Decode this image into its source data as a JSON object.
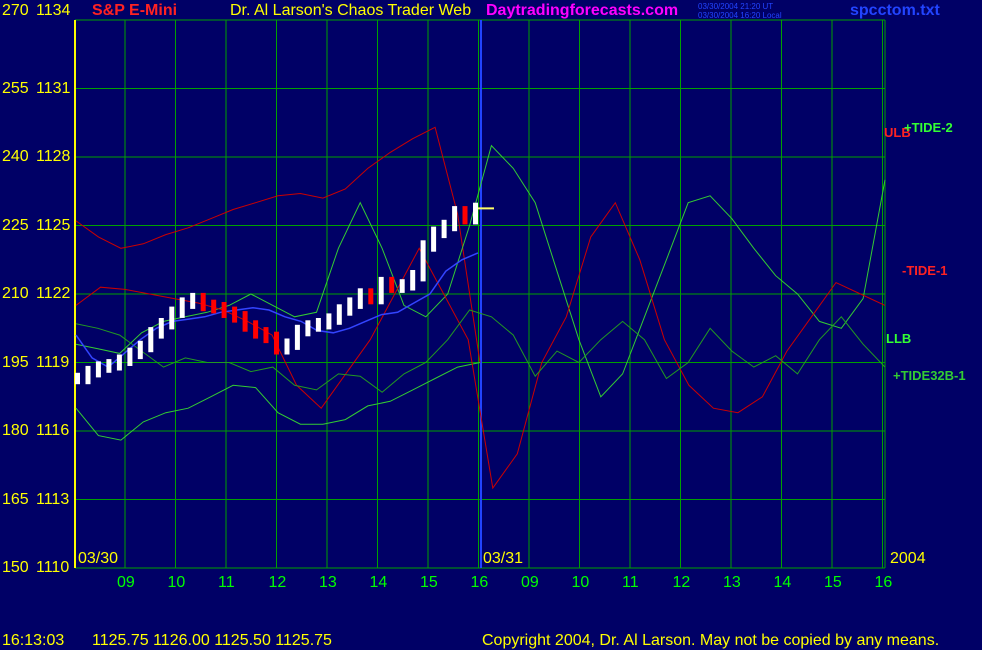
{
  "header": {
    "symbol": "S&P E-Mini",
    "title": "Dr. Al Larson's Chaos Trader Web",
    "site": "Daytradingforecasts.com",
    "timestamp_ut": "03/30/2004 21:20 UT",
    "timestamp_local": "03/30/2004 16:20 Local",
    "filename": "spcctom.txt"
  },
  "footer": {
    "time": "16:13:03",
    "ohlc": "1125.75 1126.00 1125.50 1125.75",
    "copyright": "Copyright 2004, Dr. Al Larson. May not be copied by any means."
  },
  "colors": {
    "background": "#000066",
    "grid": "#00a000",
    "price_up": "#ffffff",
    "price_down": "#ff0000",
    "ulb": "#cc0000",
    "llb": "#33cc33",
    "tide2": "#33cc33",
    "tide1": "#cc0000",
    "tide32b": "#229922",
    "average": "#3344ff",
    "fast_avg": "#ffff66",
    "axis_left": "#ffff00",
    "hour_label": "#00ff00",
    "magenta": "#ff00ff",
    "blue_text": "#2244ff"
  },
  "chart_data": {
    "type": "line",
    "title": "S&P E-Mini",
    "y_left_ticks": [
      "270",
      "255",
      "240",
      "225",
      "210",
      "195",
      "180",
      "165",
      "150"
    ],
    "y_right_ticks": [
      "1134",
      "1131",
      "1128",
      "1125",
      "1122",
      "1119",
      "1116",
      "1113",
      "1110"
    ],
    "ylim": [
      1110,
      1134
    ],
    "x_hour_labels": [
      "09",
      "10",
      "11",
      "12",
      "13",
      "14",
      "15",
      "16",
      "09",
      "10",
      "11",
      "12",
      "13",
      "14",
      "15",
      "16"
    ],
    "date_labels": [
      "03/30",
      "03/31",
      "2004"
    ],
    "series_labels": [
      {
        "text": "ULB",
        "color": "#ff2222"
      },
      {
        "text": "+TIDE-2",
        "color": "#33ff33"
      },
      {
        "text": "-TIDE-1",
        "color": "#ff2222"
      },
      {
        "text": "LLB",
        "color": "#33ff33"
      },
      {
        "text": "+TIDE32B-1",
        "color": "#33cc33"
      }
    ],
    "price": [
      1118.3,
      1118.6,
      1118.8,
      1118.9,
      1119.1,
      1119.4,
      1119.7,
      1120.3,
      1120.7,
      1121.2,
      1121.6,
      1121.8,
      1121.5,
      1121.4,
      1121.2,
      1121.0,
      1120.6,
      1120.3,
      1120.1,
      1119.6,
      1119.8,
      1120.4,
      1120.6,
      1120.7,
      1120.9,
      1121.3,
      1121.6,
      1122.0,
      1121.8,
      1122.5,
      1122.3,
      1122.4,
      1122.8,
      1124.1,
      1124.7,
      1125.0,
      1125.6,
      1125.3,
      1125.75
    ],
    "ulb": [
      1125.2,
      1124.5,
      1124.0,
      1124.2,
      1124.6,
      1124.9,
      1125.3,
      1125.7,
      1126.0,
      1126.3,
      1126.4,
      1126.2,
      1126.6,
      1127.5,
      1128.2,
      1128.8,
      1129.3,
      1125.5,
      1119.0
    ],
    "llb": [
      1117.0,
      1115.8,
      1115.6,
      1116.4,
      1116.8,
      1117.0,
      1117.5,
      1118.0,
      1117.9,
      1116.8,
      1116.3,
      1116.3,
      1116.5,
      1117.1,
      1117.3,
      1117.8,
      1118.3,
      1118.8,
      1119.0
    ],
    "tide2": [
      1119.8,
      1119.6,
      1119.4,
      1120.3,
      1120.8,
      1121.0,
      1121.2,
      1121.5,
      1122.0,
      1121.5,
      1121.0,
      1121.2,
      1124.0,
      1126.0,
      1124.0,
      1121.5,
      1121.0,
      1122.0,
      1125.0,
      1128.5,
      1127.5,
      1126.0,
      1123.0,
      1120.0,
      1117.5,
      1118.5,
      1121.0,
      1123.5,
      1126.0,
      1126.3,
      1125.3,
      1124.0,
      1122.8,
      1122.0,
      1120.8,
      1120.5,
      1121.8,
      1127.0
    ],
    "tide1": [
      1121.5,
      1122.3,
      1122.2,
      1122.0,
      1121.8,
      1121.6,
      1121.3,
      1120.8,
      1120.2,
      1118.0,
      1117.0,
      1118.5,
      1120.0,
      1122.0,
      1124.0,
      1122.0,
      1120.0,
      1113.5,
      1115.0,
      1119.0,
      1121.0,
      1124.5,
      1126.0,
      1123.5,
      1120.0,
      1118.0,
      1117.0,
      1116.8,
      1117.5,
      1119.5,
      1121.0,
      1122.5,
      1122.0,
      1121.5
    ],
    "tide32b": [
      1120.7,
      1120.5,
      1120.2,
      1119.5,
      1118.8,
      1119.2,
      1119.0,
      1119.0,
      1118.6,
      1118.8,
      1118.0,
      1117.8,
      1118.5,
      1118.4,
      1117.7,
      1118.5,
      1119.0,
      1120.0,
      1121.3,
      1121.0,
      1120.2,
      1118.4,
      1119.5,
      1119.0,
      1120.0,
      1120.8,
      1120.0,
      1118.3,
      1119.0,
      1120.5,
      1119.5,
      1118.8,
      1119.3,
      1118.5,
      1120.0,
      1121.0,
      1119.8,
      1118.8
    ],
    "average": [
      1120.2,
      1119.2,
      1118.8,
      1119.4,
      1120.0,
      1120.5,
      1120.8,
      1120.9,
      1121.0,
      1121.2,
      1121.3,
      1121.4,
      1121.3,
      1121.0,
      1120.8,
      1120.4,
      1120.3,
      1120.5,
      1120.8,
      1121.1,
      1121.2,
      1121.6,
      1122.0,
      1123.0,
      1123.5,
      1123.8
    ]
  }
}
